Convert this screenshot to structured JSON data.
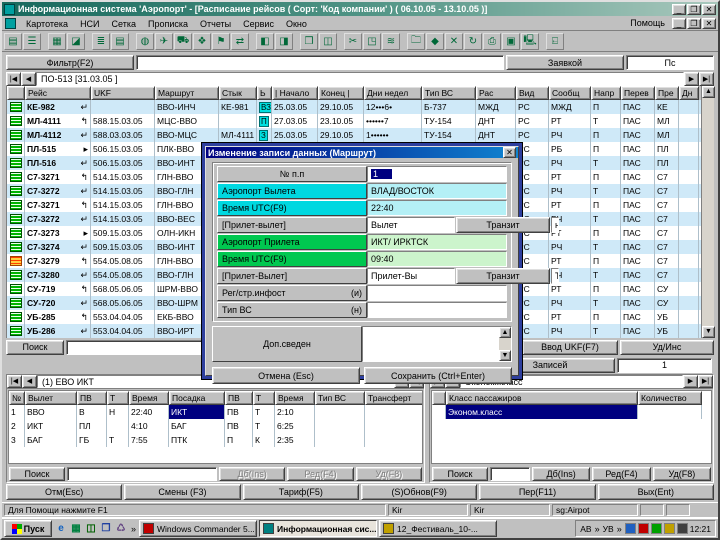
{
  "window": {
    "title": "Информационная система 'Аэропорт' - [Расписание рейсов ( Сорт: 'Код компании' ) ( 06.10.05 - 13.10.05 )]",
    "menu": [
      "Картотека",
      "НСИ",
      "Сетка",
      "Прописка",
      "Отчеты",
      "Сервис",
      "Окно"
    ],
    "menu_right": "Помощь",
    "min": "_",
    "max": "❐",
    "close": "✕"
  },
  "toolbar": {
    "icons": [
      {
        "name": "schedule-icon",
        "glyph": "▤",
        "group": 0
      },
      {
        "name": "traffic-icon",
        "glyph": "☰",
        "group": 0
      },
      {
        "name": "grid-icon",
        "glyph": "▦",
        "group": 1
      },
      {
        "name": "chart-icon",
        "glyph": "◪",
        "group": 1
      },
      {
        "name": "list-icon",
        "glyph": "≣",
        "group": 2
      },
      {
        "name": "sort-icon",
        "glyph": "▤",
        "group": 2
      },
      {
        "name": "globe-icon",
        "glyph": "◍",
        "group": 3
      },
      {
        "name": "plane-dep-icon",
        "glyph": "✈",
        "group": 3
      },
      {
        "name": "plane-arr-icon",
        "glyph": "⛟",
        "group": 3
      },
      {
        "name": "truck-icon",
        "glyph": "❖",
        "group": 3
      },
      {
        "name": "flag-icon",
        "glyph": "⚑",
        "group": 3
      },
      {
        "name": "link-icon",
        "glyph": "⇄",
        "group": 3
      },
      {
        "name": "door-icon",
        "glyph": "◧",
        "group": 4
      },
      {
        "name": "card-icon",
        "glyph": "◨",
        "group": 4
      },
      {
        "name": "frame-icon",
        "glyph": "❒",
        "group": 5
      },
      {
        "name": "lock-icon",
        "glyph": "◫",
        "group": 5
      },
      {
        "name": "tools-icon",
        "glyph": "✂",
        "group": 6
      },
      {
        "name": "book-icon",
        "glyph": "◳",
        "group": 6
      },
      {
        "name": "merge-icon",
        "glyph": "≋",
        "group": 6
      },
      {
        "name": "folder-icon",
        "glyph": "🗀",
        "group": 7
      },
      {
        "name": "diamond-icon",
        "glyph": "◆",
        "group": 7
      },
      {
        "name": "percent-icon",
        "glyph": "✕",
        "group": 7
      },
      {
        "name": "refresh-icon",
        "glyph": "↻",
        "group": 7
      },
      {
        "name": "printer-icon",
        "glyph": "⎙",
        "group": 7
      },
      {
        "name": "mail-icon",
        "glyph": "▣",
        "group": 7
      },
      {
        "name": "screen-icon",
        "glyph": "🖳",
        "group": 7
      },
      {
        "name": "exit-icon",
        "glyph": "⍇",
        "group": 8
      }
    ]
  },
  "filter": {
    "button": "Фильтр(F2)",
    "value": "",
    "right_button": "Заявкой",
    "right_value": "Пс"
  },
  "nav": {
    "label": "ПО-513 [31.03.05 ]"
  },
  "flight_table": {
    "columns": [
      "",
      "Рейс",
      "UKF",
      "Маршрут",
      "Стык",
      "Ь",
      "| Начало",
      "Конец |",
      "Дни недел",
      "Тип ВС",
      "Рас",
      "Вид",
      "Сообщ",
      "Напр",
      "Перев",
      "Пре",
      "Дн"
    ],
    "rows": [
      {
        "icon": "g",
        "flight": "КЕ-982",
        "dir": "↵",
        "ukf": "",
        "route": "ВВО-ИНЧ",
        "link": "КЕ-981",
        "b": "ВЗ",
        "start": "25.03.05",
        "end": "29.10.05",
        "days": "12•••6•",
        "actype": "Б-737",
        "ras": "МЖД",
        "vid": "РС",
        "soob": "МЖД",
        "napr": "П",
        "perev": "ПАС",
        "pre": "КЕ",
        "dn": ""
      },
      {
        "icon": "g",
        "flight": "МЛ-4111",
        "dir": "↰",
        "ukf": "588.15.03.05",
        "route": "МЦС-ВВО",
        "link": "",
        "b": "П",
        "start": "27.03.05",
        "end": "23.10.05",
        "days": "••••••7",
        "actype": "ТУ-154",
        "ras": "ДНТ",
        "vid": "РС",
        "soob": "РТ",
        "napr": "Т",
        "perev": "ПАС",
        "pre": "МЛ",
        "dn": ""
      },
      {
        "icon": "g",
        "flight": "МЛ-4112",
        "dir": "↵",
        "ukf": "588.03.03.05",
        "route": "ВВО-МЦС",
        "link": "МЛ-4111",
        "b": "З",
        "start": "25.03.05",
        "end": "29.10.05",
        "days": "1••••••",
        "actype": "ТУ-154",
        "ras": "ДНТ",
        "vid": "РС",
        "soob": "РЧ",
        "napr": "П",
        "perev": "ПАС",
        "pre": "МЛ",
        "dn": ""
      },
      {
        "icon": "g",
        "flight": "ПЛ-515",
        "dir": "▸",
        "ukf": "506.15.03.05",
        "route": "ПЛК-ВВО",
        "link": "",
        "b": "",
        "start": "",
        "end": "",
        "days": "",
        "actype": "",
        "ras": "",
        "vid": "РС",
        "soob": "РБ",
        "napr": "П",
        "perev": "ПАС",
        "pre": "ПЛ",
        "dn": ""
      },
      {
        "icon": "g",
        "flight": "ПЛ-516",
        "dir": "↵",
        "ukf": "506.15.03.05",
        "route": "ВВО-ИНТ",
        "link": "",
        "b": "",
        "start": "",
        "end": "",
        "days": "",
        "actype": "",
        "ras": "",
        "vid": "РС",
        "soob": "РЧ",
        "napr": "Т",
        "perev": "ПАС",
        "pre": "ПЛ",
        "dn": ""
      },
      {
        "icon": "g",
        "flight": "С7-3271",
        "dir": "↰",
        "ukf": "514.15.03.05",
        "route": "ГЛН-ВВО",
        "link": "",
        "b": "",
        "start": "",
        "end": "",
        "days": "",
        "actype": "",
        "ras": "",
        "vid": "РС",
        "soob": "РТ",
        "napr": "П",
        "perev": "ПАС",
        "pre": "С7",
        "dn": ""
      },
      {
        "icon": "g",
        "flight": "С7-3272",
        "dir": "↵",
        "ukf": "514.15.03.05",
        "route": "ВВО-ГЛН",
        "link": "",
        "b": "",
        "start": "",
        "end": "",
        "days": "",
        "actype": "",
        "ras": "",
        "vid": "РС",
        "soob": "РЧ",
        "napr": "Т",
        "perev": "ПАС",
        "pre": "С7",
        "dn": ""
      },
      {
        "icon": "g",
        "flight": "С7-3271",
        "dir": "↰",
        "ukf": "514.15.03.05",
        "route": "ГЛН-ВВО",
        "link": "",
        "b": "",
        "start": "",
        "end": "",
        "days": "",
        "actype": "",
        "ras": "",
        "vid": "РС",
        "soob": "РТ",
        "napr": "П",
        "perev": "ПАС",
        "pre": "С7",
        "dn": ""
      },
      {
        "icon": "g",
        "flight": "С7-3272",
        "dir": "↵",
        "ukf": "514.15.03.05",
        "route": "ВВО-ВЕС",
        "link": "",
        "b": "",
        "start": "",
        "end": "",
        "days": "",
        "actype": "",
        "ras": "",
        "vid": "РС",
        "soob": "РЧ",
        "napr": "Т",
        "perev": "ПАС",
        "pre": "С7",
        "dn": ""
      },
      {
        "icon": "g",
        "flight": "С7-3273",
        "dir": "▸",
        "ukf": "509.15.03.05",
        "route": "ОЛН-ИКН",
        "link": "",
        "b": "",
        "start": "",
        "end": "",
        "days": "",
        "actype": "",
        "ras": "",
        "vid": "РС",
        "soob": "РТ",
        "napr": "П",
        "perev": "ПАС",
        "pre": "С7",
        "dn": ""
      },
      {
        "icon": "g",
        "flight": "С7-3274",
        "dir": "↵",
        "ukf": "509.15.03.05",
        "route": "ВВО-ИНТ",
        "link": "",
        "b": "",
        "start": "",
        "end": "",
        "days": "",
        "actype": "",
        "ras": "",
        "vid": "РС",
        "soob": "РЧ",
        "napr": "Т",
        "perev": "ПАС",
        "pre": "С7",
        "dn": ""
      },
      {
        "icon": "a",
        "flight": "С7-3279",
        "dir": "↰",
        "ukf": "554.05.08.05",
        "route": "ГЛН-ВВО",
        "link": "",
        "b": "",
        "start": "",
        "end": "",
        "days": "",
        "actype": "",
        "ras": "",
        "vid": "РС",
        "soob": "РТ",
        "napr": "П",
        "perev": "ПАС",
        "pre": "С7",
        "dn": ""
      },
      {
        "icon": "g",
        "flight": "С7-3280",
        "dir": "↵",
        "ukf": "554.05.08.05",
        "route": "ВВО-ГЛН",
        "link": "",
        "b": "",
        "start": "",
        "end": "",
        "days": "",
        "actype": "",
        "ras": "",
        "vid": "РС",
        "soob": "РЧ",
        "napr": "Т",
        "perev": "ПАС",
        "pre": "С7",
        "dn": ""
      },
      {
        "icon": "g",
        "flight": "СУ-719",
        "dir": "↰",
        "ukf": "568.05.06.05",
        "route": "ШРМ-ВВО",
        "link": "",
        "b": "",
        "start": "",
        "end": "",
        "days": "",
        "actype": "",
        "ras": "",
        "vid": "РС",
        "soob": "РТ",
        "napr": "П",
        "perev": "ПАС",
        "pre": "СУ",
        "dn": ""
      },
      {
        "icon": "g",
        "flight": "СУ-720",
        "dir": "↵",
        "ukf": "568.05.06.05",
        "route": "ВВО-ШРМ",
        "link": "",
        "b": "",
        "start": "",
        "end": "",
        "days": "",
        "actype": "",
        "ras": "",
        "vid": "РС",
        "soob": "РЧ",
        "napr": "Т",
        "perev": "ПАС",
        "pre": "СУ",
        "dn": ""
      },
      {
        "icon": "g",
        "flight": "УБ-285",
        "dir": "↰",
        "ukf": "553.04.04.05",
        "route": "ЕКБ-ВВО",
        "link": "",
        "b": "",
        "start": "",
        "end": "",
        "days": "",
        "actype": "",
        "ras": "",
        "vid": "РС",
        "soob": "РТ",
        "napr": "П",
        "perev": "ПАС",
        "pre": "УБ",
        "dn": ""
      },
      {
        "icon": "g",
        "flight": "УБ-286",
        "dir": "↵",
        "ukf": "553.04.04.05",
        "route": "ВВО-ИРТ",
        "link": "",
        "b": "",
        "start": "",
        "end": "",
        "days": "",
        "actype": "",
        "ras": "",
        "vid": "РС",
        "soob": "РЧ",
        "napr": "Т",
        "perev": "ПАС",
        "pre": "УБ",
        "dn": ""
      }
    ]
  },
  "search_row": {
    "search": "Поиск",
    "value": "",
    "ukf_button": "Ввод UKF(F7)",
    "del_button": "Уд/Инс"
  },
  "records": {
    "label": "Записей",
    "value": "1"
  },
  "route_panel": {
    "nav": "(1) ЕВО  ИКТ",
    "columns": [
      "№",
      "Вылет",
      "ПВ",
      "Т",
      "Время",
      "Посадка",
      "ПВ",
      "Т",
      "Время",
      "Тип ВС",
      "Трансферт"
    ],
    "rows": [
      [
        "1",
        "ВВО",
        "В",
        "Н",
        "22:40",
        "ИКТ",
        "ПВ",
        "Т",
        "2:10",
        "",
        ""
      ],
      [
        "2",
        "ИКТ",
        "ПЛ",
        "",
        "4:10",
        "БАГ",
        "ПВ",
        "Т",
        "6:25",
        "",
        ""
      ],
      [
        "3",
        "БАГ",
        "ГБ",
        "Т",
        "7:55",
        "ПТК",
        "П",
        "К",
        "2:35",
        "",
        ""
      ]
    ],
    "selected": {
      "row": 0,
      "col": 5
    },
    "search": "Поиск",
    "buttons": [
      "Дб(Ins)",
      "Ред(F4)",
      "Уд(F8)"
    ]
  },
  "class_panel": {
    "nav": "Эконом.класс",
    "columns": [
      "",
      "Класс пассажиров",
      "Количество"
    ],
    "rows": [
      [
        "",
        "Эконом.класс",
        ""
      ]
    ],
    "selected": {
      "row": 0,
      "col": 1
    },
    "search": "Поиск",
    "buttons": [
      "Дб(Ins)",
      "Ред(F4)",
      "Уд(F8)"
    ]
  },
  "dialog": {
    "title": "Изменение записи данных  (Маршрут)",
    "close": "✕",
    "num_label": "№ п.п",
    "num_value": "1",
    "dep_label": "Аэропорт Вылета",
    "dep_value": "ВЛАД/ВОСТОК",
    "dep_time_label": "Время UTC(F9)",
    "dep_time_value": "22:40",
    "dep_type_label": "[Прилет-вылет]",
    "dep_type_value": "Вылет",
    "dep_transit": "Транзит",
    "dep_kind": "начальный",
    "arr_label": "Аэропорт Прилета",
    "arr_value": "ИКТ/ ИРКТСК",
    "arr_time_label": "Время UTC(F9)",
    "arr_time_value": "09:40",
    "arr_type_label": "[Прилет-Вылет]",
    "arr_type_value": "Прилет-Вы",
    "arr_transit": "Транзит",
    "arr_kind": "Транзитный",
    "reg_label": "Рег/стр.инфост",
    "reg_suffix": "(и)",
    "reg_value": "",
    "actype_label": "Тип ВС",
    "actype_suffix": "(н)",
    "actype_value": "",
    "notes_label": "Доп.сведен",
    "notes_value": "",
    "cancel": "Отмена (Esc)",
    "save": "Сохранить (Ctrl+Enter)"
  },
  "bottom_buttons": [
    "Отм(Esc)",
    "Смены (F3)",
    "Тариф(F5)",
    "(S)Обнов(F9)",
    "Пер(F11)",
    "Вых(Ent)"
  ],
  "statusbar": {
    "fields": [
      "Для Помощи нажмите F1",
      "Kir",
      "Kir",
      "sg:Airpot",
      "",
      ""
    ]
  },
  "taskbar": {
    "start": "Пуск",
    "quick_icons": [
      {
        "name": "ie-icon",
        "glyph": "e",
        "color": "#1060c0"
      },
      {
        "name": "desktop-icon",
        "glyph": "▦",
        "color": "#008040"
      },
      {
        "name": "excel-icon",
        "glyph": "◫",
        "color": "#006000"
      },
      {
        "name": "word-icon",
        "glyph": "❒",
        "color": "#2040a0"
      },
      {
        "name": "recycle-icon",
        "glyph": "♺",
        "color": "#604080"
      }
    ],
    "chevron": "»",
    "tasks": [
      {
        "label": "Windows Commander 5...",
        "color": "#c00000",
        "active": false
      },
      {
        "label": "Информационная сис...",
        "color": "#008080",
        "active": true
      },
      {
        "label": "12_Фестиваль_10-...",
        "color": "#c0a000",
        "active": false
      }
    ],
    "lang1": "АВ",
    "lang2": "УВ",
    "clock": "12:21"
  },
  "colors": {
    "titlebar": "#17695d",
    "selection": "#000080",
    "row_alt": "#cfe9f8",
    "badge": "#00e0e0"
  }
}
